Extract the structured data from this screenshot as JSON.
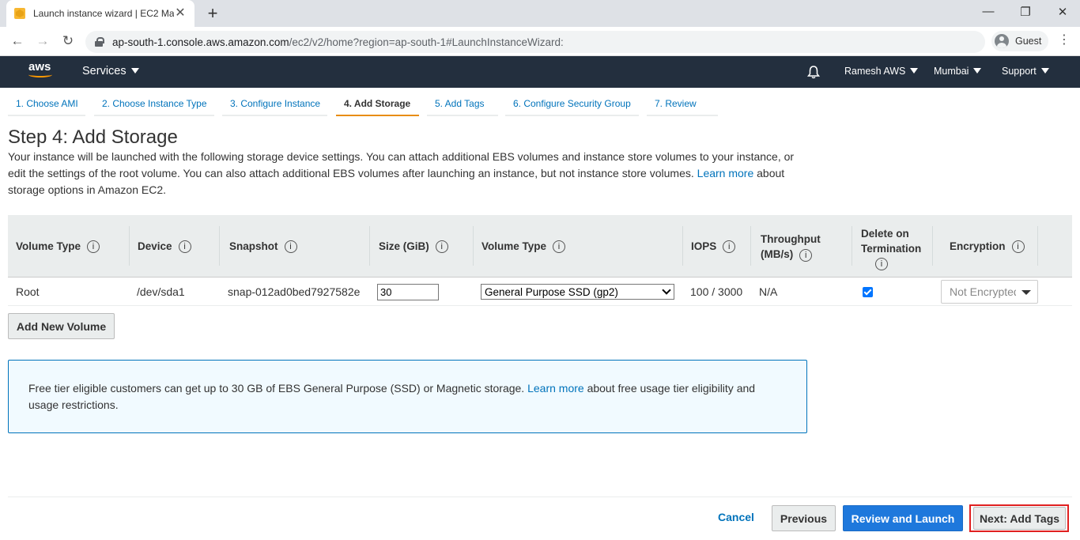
{
  "browser": {
    "tab_title": "Launch instance wizard | EC2 Ma",
    "url_host": "ap-south-1.console.aws.amazon.com",
    "url_path": "/ec2/v2/home?region=ap-south-1#LaunchInstanceWizard:",
    "profile_label": "Guest"
  },
  "aws_header": {
    "logo_text": "aws",
    "services_label": "Services",
    "account_label": "Ramesh AWS",
    "region_label": "Mumbai",
    "support_label": "Support"
  },
  "wizard": {
    "steps": [
      {
        "label": "1. Choose AMI"
      },
      {
        "label": "2. Choose Instance Type"
      },
      {
        "label": "3. Configure Instance"
      },
      {
        "label": "4. Add Storage"
      },
      {
        "label": "5. Add Tags"
      },
      {
        "label": "6. Configure Security Group"
      },
      {
        "label": "7. Review"
      }
    ],
    "active_step": "4. Add Storage"
  },
  "page": {
    "title": "Step 4: Add Storage",
    "intro_text": "Your instance will be launched with the following storage device settings. You can attach additional EBS volumes and instance store volumes to your instance, or edit the settings of the root volume. You can also attach additional EBS volumes after launching an instance, but not instance store volumes.",
    "intro_link": "Learn more",
    "intro_tail": "about storage options in Amazon EC2."
  },
  "storage_table": {
    "headers": {
      "volume_type": "Volume Type",
      "device": "Device",
      "snapshot": "Snapshot",
      "size": "Size (GiB)",
      "ebs_volume_type": "Volume Type",
      "iops": "IOPS",
      "throughput": "Throughput (MB/s)",
      "delete_on_termination": "Delete on Termination",
      "encryption": "Encryption"
    },
    "row": {
      "volume_type": "Root",
      "device": "/dev/sda1",
      "snapshot": "snap-012ad0bed7927582e",
      "size": "30",
      "ebs_volume_type": "General Purpose SSD (gp2)",
      "iops": "100 / 3000",
      "throughput": "N/A",
      "delete_on_termination": true,
      "encryption": "Not Encrypted"
    }
  },
  "add_volume_label": "Add New Volume",
  "notice": {
    "text": "Free tier eligible customers can get up to 30 GB of EBS General Purpose (SSD) or Magnetic storage.",
    "link": "Learn more",
    "tail": "about free usage tier eligibility and usage restrictions."
  },
  "footer": {
    "cancel_label": "Cancel",
    "previous_label": "Previous",
    "review_label": "Review and Launch",
    "next_label": "Next: Add Tags"
  },
  "colors": {
    "aws_nav_bg": "#232f3e",
    "aws_orange": "#ff9900",
    "link_blue": "#0073bb",
    "primary_button": "#1e78dc",
    "highlight_red": "#e02020"
  }
}
